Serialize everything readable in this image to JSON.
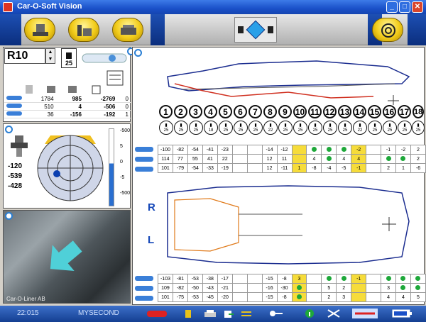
{
  "window": {
    "title": "Car-O-Soft Vision"
  },
  "left": {
    "reference": "R10",
    "clamp_count": "25",
    "measure_rows": [
      [
        "1784",
        "985",
        "-2769",
        "0"
      ],
      [
        "510",
        "4",
        "-506",
        "0"
      ],
      [
        "36",
        "-156",
        "-192",
        "1"
      ]
    ],
    "coords": [
      "-120",
      "-539",
      "-428"
    ],
    "scale": [
      "-500",
      "5",
      "0",
      "-5",
      "-500"
    ],
    "photo_caption": "Car-O-Liner AB"
  },
  "points": [
    "1",
    "2",
    "3",
    "4",
    "5",
    "6",
    "7",
    "8",
    "9",
    "10",
    "11",
    "12",
    "13",
    "14",
    "15",
    "16",
    "17",
    "18"
  ],
  "clamps": [
    "25",
    "25",
    "25",
    "18",
    "25",
    "25",
    "25",
    "22",
    "25",
    "25",
    "25",
    "25",
    "25",
    "22",
    "25",
    "25",
    "25",
    "25"
  ],
  "top_table": [
    [
      "-100",
      "-82",
      "-54",
      "-41",
      "-23",
      "",
      "",
      "-14",
      "-12",
      "Y",
      "G",
      "G",
      "G",
      "-2Y",
      "",
      "-1",
      "-2",
      "2"
    ],
    [
      "114",
      "77",
      "55",
      "41",
      "22",
      "",
      "",
      "12",
      "11",
      "Y",
      "4",
      "G",
      "4",
      "4Y",
      "",
      "G",
      "G",
      "2"
    ],
    [
      "101",
      "-79",
      "-54",
      "-33",
      "-19",
      "",
      "",
      "12",
      "-11",
      "1Y",
      "-8",
      "-4",
      "-5",
      "-1Y",
      "",
      "2",
      "1",
      "-6"
    ]
  ],
  "bottom_table": [
    [
      "-103",
      "-81",
      "-53",
      "-38",
      "-17",
      "",
      "",
      "-15",
      "-8",
      "3Y",
      "",
      "G",
      "G",
      "-1Y",
      "",
      "G",
      "G",
      "G"
    ],
    [
      "109",
      "-82",
      "-50",
      "-43",
      "-21",
      "",
      "",
      "-16",
      "-30",
      "GY",
      "",
      "5",
      "2",
      "Y",
      "",
      "3",
      "G",
      "G"
    ],
    [
      "101",
      "-75",
      "-53",
      "-45",
      "-20",
      "",
      "",
      "-15",
      "-8",
      "GY",
      "",
      "2",
      "3",
      "Y",
      "",
      "4",
      "4",
      "5"
    ]
  ],
  "side_labels": {
    "right": "R",
    "left": "L"
  },
  "status": {
    "time": "22:015",
    "name": "MYSECOND"
  },
  "colors": {
    "accent": "#1a50c8",
    "highlight": "#f6dc3a",
    "ok": "#1ea83a"
  }
}
